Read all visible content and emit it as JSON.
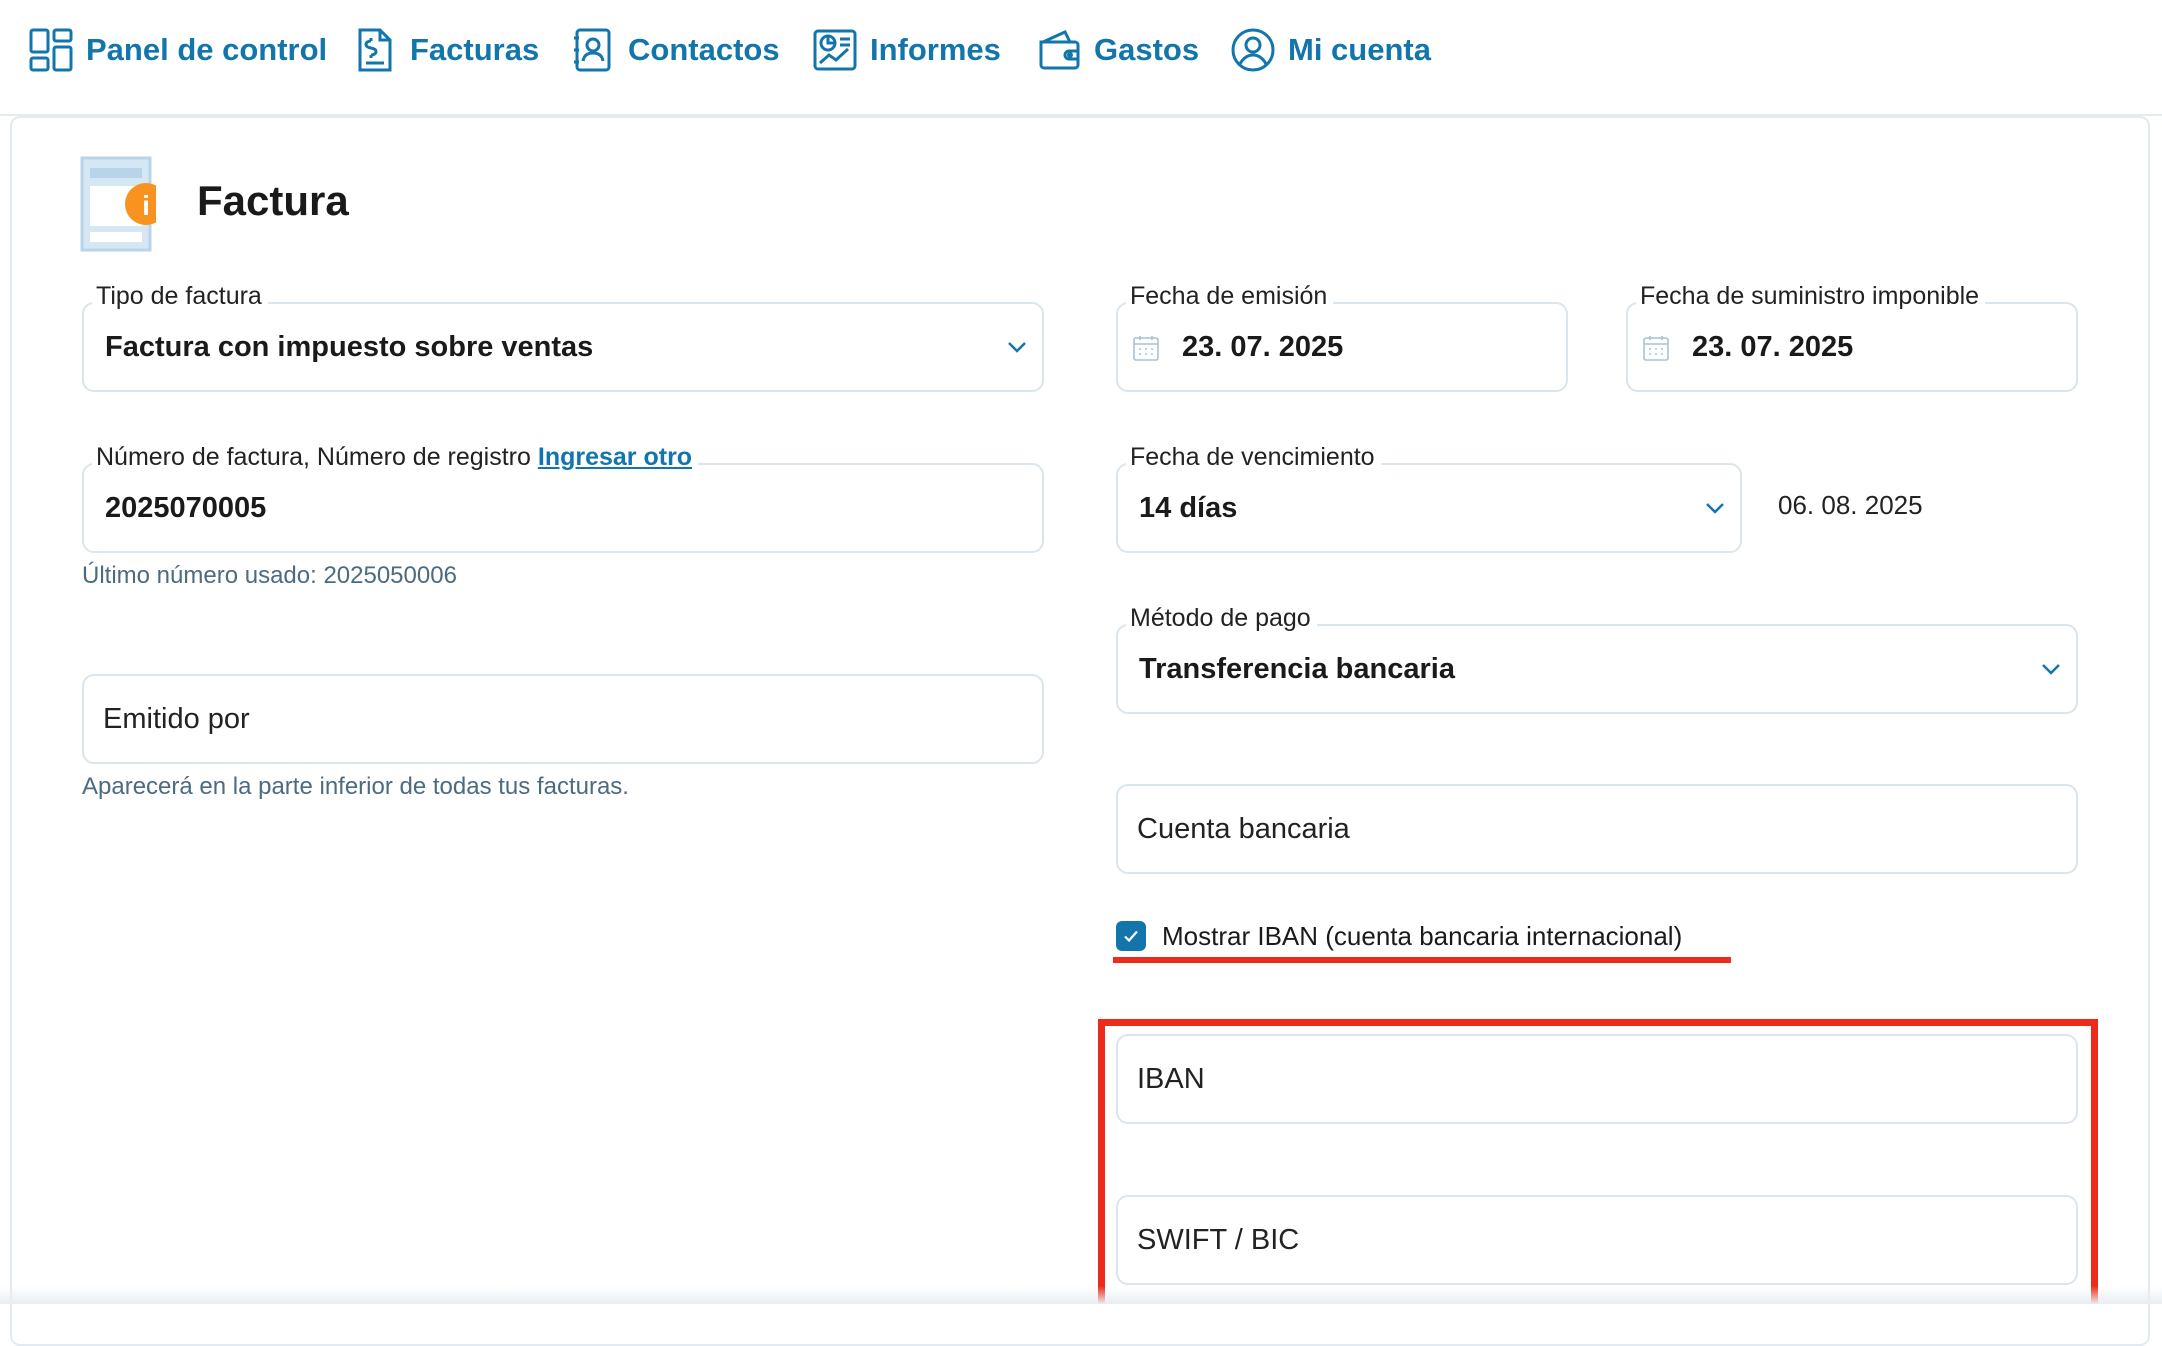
{
  "nav": {
    "items": [
      {
        "label": "Panel de control",
        "icon": "dashboard-icon"
      },
      {
        "label": "Facturas",
        "icon": "invoice-icon"
      },
      {
        "label": "Contactos",
        "icon": "contacts-icon"
      },
      {
        "label": "Informes",
        "icon": "reports-icon"
      },
      {
        "label": "Gastos",
        "icon": "wallet-icon"
      },
      {
        "label": "Mi cuenta",
        "icon": "user-icon"
      }
    ]
  },
  "header": {
    "title": "Factura",
    "icon": "invoice-info-icon"
  },
  "form": {
    "invoice_type": {
      "label": "Tipo de factura",
      "value": "Factura con impuesto sobre ventas"
    },
    "issue_date": {
      "label": "Fecha de emisión",
      "value": "23. 07. 2025"
    },
    "supply_date": {
      "label": "Fecha de suministro imponible",
      "value": "23. 07. 2025"
    },
    "invoice_number": {
      "label": "Número de factura, Número de registro",
      "link": "Ingresar otro",
      "value": "2025070005",
      "hint": "Último número usado: 2025050006"
    },
    "due": {
      "label": "Fecha de vencimiento",
      "value": "14 días",
      "date": "06. 08. 2025"
    },
    "payment_method": {
      "label": "Método de pago",
      "value": "Transferencia bancaria"
    },
    "issued_by": {
      "placeholder": "Emitido por",
      "hint": "Aparecerá en la parte inferior de todas tus facturas."
    },
    "bank_account": {
      "placeholder": "Cuenta bancaria"
    },
    "show_iban": {
      "label": "Mostrar IBAN (cuenta bancaria internacional)",
      "checked": true
    },
    "iban": {
      "placeholder": "IBAN"
    },
    "swift": {
      "placeholder": "SWIFT / BIC"
    }
  },
  "colors": {
    "accent": "#1276ad",
    "highlight": "#ee2b1a",
    "info_badge": "#f7931e"
  }
}
